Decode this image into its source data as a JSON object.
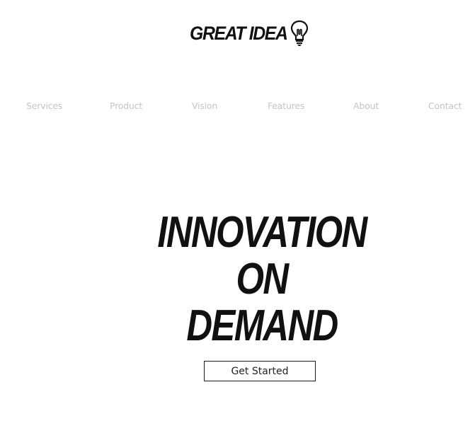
{
  "header": {
    "logo_text": "GREAT IDEA",
    "logo_icon": "lightbulb-icon"
  },
  "nav": {
    "items": [
      {
        "label": "Services"
      },
      {
        "label": "Product"
      },
      {
        "label": "Vision"
      },
      {
        "label": "Features"
      },
      {
        "label": "About"
      },
      {
        "label": "Contact"
      }
    ]
  },
  "hero": {
    "lines": [
      "INNOVATION",
      "ON",
      "DEMAND"
    ],
    "cta_label": "Get Started"
  },
  "colors": {
    "text": "#111111",
    "nav_text": "#c4c4c4",
    "background": "#ffffff"
  }
}
